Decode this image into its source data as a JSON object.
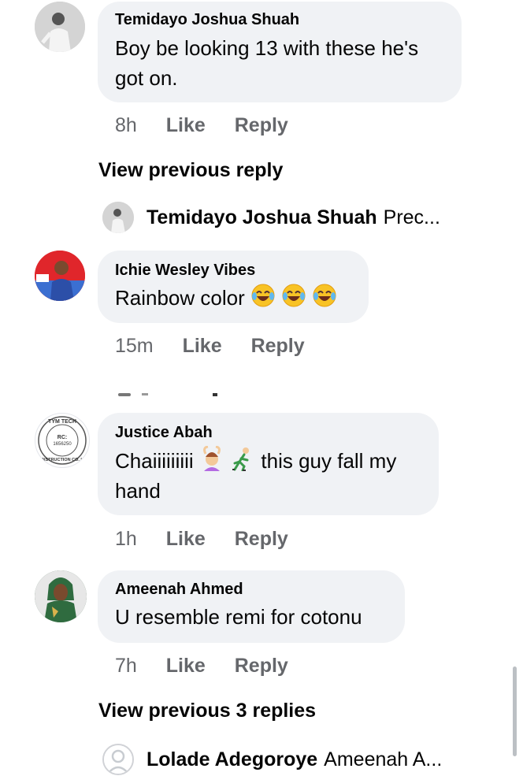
{
  "comments": [
    {
      "author": "Temidayo Joshua Shuah",
      "text_line1": "Boy be looking 13 with these he's",
      "text_line2": "got on.",
      "time": "8h",
      "like": "Like",
      "reply": "Reply",
      "avatar_color": "#cfcfcf"
    },
    {
      "author": "Ichie Wesley Vibes",
      "text": "Rainbow color",
      "emojis": [
        "face-with-tears-of-joy",
        "face-with-tears-of-joy",
        "face-with-tears-of-joy"
      ],
      "time": "15m",
      "like": "Like",
      "reply": "Reply",
      "avatar_color": "#e0262b"
    },
    {
      "author": "Justice Abah",
      "text_line1_a": "Chaiiiiiiiii",
      "text_line1_b": "this guy fall my",
      "text_line2": "hand",
      "emojis": [
        "person-gesturing-ok",
        "person-running"
      ],
      "time": "1h",
      "like": "Like",
      "reply": "Reply",
      "avatar_stamp_top": "TYM TECH",
      "avatar_stamp_rc": "RC:",
      "avatar_stamp_num": "1656250",
      "avatar_stamp_bottom": "CONSTRUCTION CO. LTD"
    },
    {
      "author": "Ameenah Ahmed",
      "text": "U resemble remi for cotonu",
      "time": "7h",
      "like": "Like",
      "reply": "Reply",
      "avatar_color": "#2e5b3a"
    }
  ],
  "view_previous_1": "View previous reply",
  "reply_preview_1": {
    "name": "Temidayo Joshua Shuah",
    "text": "Prec..."
  },
  "view_previous_2": "View previous 3 replies",
  "reply_preview_2": {
    "name": "Lolade Adegoroye",
    "text": "Ameenah A..."
  },
  "colors": {
    "bubble": "#f0f2f5",
    "meta": "#65676b",
    "text": "#050505"
  }
}
